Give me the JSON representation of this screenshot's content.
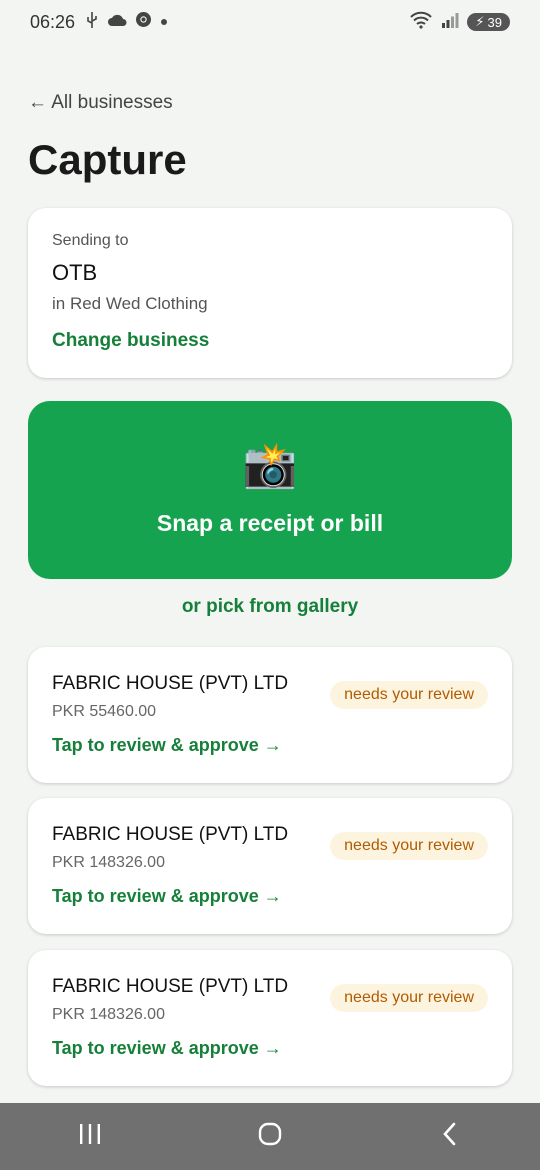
{
  "status_bar": {
    "time": "06:26",
    "battery": "39",
    "icons": [
      "usb-icon",
      "cloud-icon",
      "chrome-icon",
      "dot-icon",
      "wifi-icon",
      "signal-icon",
      "battery-icon"
    ]
  },
  "header": {
    "back_label": "← All businesses",
    "title": "Capture"
  },
  "sending": {
    "label": "Sending to",
    "business": "OTB",
    "group": "in Red Wed Clothing",
    "change_label": "Change business"
  },
  "snap": {
    "icon": "📸",
    "label": "Snap a receipt or bill",
    "color": "#16a34f"
  },
  "gallery_label": "or pick from gallery",
  "receipts": [
    {
      "vendor": "FABRIC HOUSE (PVT) LTD",
      "amount": "PKR 55460.00",
      "status": "needs your review",
      "action": "Tap to review & approve →"
    },
    {
      "vendor": "FABRIC HOUSE (PVT) LTD",
      "amount": "PKR 148326.00",
      "status": "needs your review",
      "action": "Tap to review & approve →"
    },
    {
      "vendor": "FABRIC HOUSE (PVT) LTD",
      "amount": "PKR 148326.00",
      "status": "needs your review",
      "action": "Tap to review & approve →"
    }
  ],
  "colors": {
    "accent": "#16803a",
    "badge_bg": "#fdf4e0",
    "badge_text": "#b25b00"
  }
}
